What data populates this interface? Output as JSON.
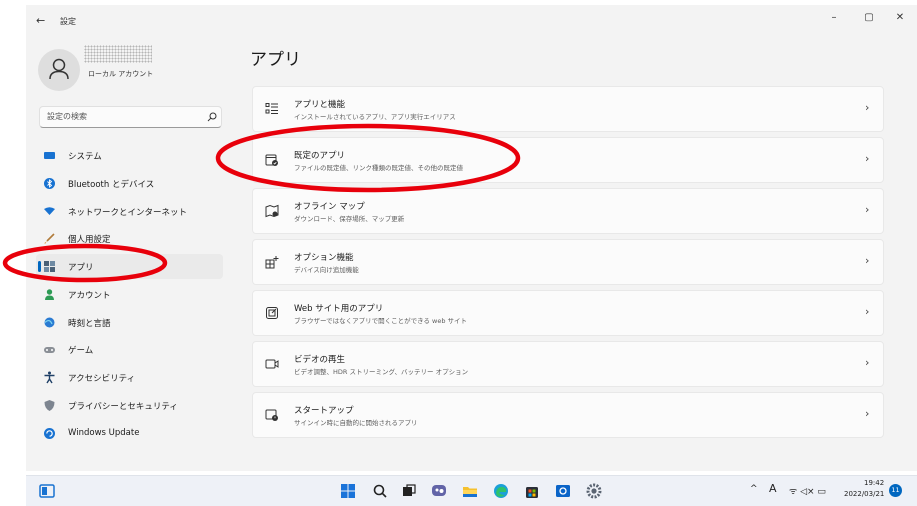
{
  "window": {
    "back": "←",
    "app_title": "設定",
    "controls": {
      "minimize": "–",
      "maximize": "▢",
      "close": "✕"
    }
  },
  "user": {
    "account_type": "ローカル アカウント"
  },
  "search": {
    "placeholder": "設定の検索"
  },
  "nav": {
    "selected": "アプリ",
    "items": [
      {
        "label": "システム",
        "icon": "monitor-icon"
      },
      {
        "label": "Bluetooth とデバイス",
        "icon": "bluetooth-icon"
      },
      {
        "label": "ネットワークとインターネット",
        "icon": "wifi-icon"
      },
      {
        "label": "個人用設定",
        "icon": "brush-icon"
      },
      {
        "label": "アプリ",
        "icon": "apps-icon"
      },
      {
        "label": "アカウント",
        "icon": "person-icon"
      },
      {
        "label": "時刻と言語",
        "icon": "globe-clock-icon"
      },
      {
        "label": "ゲーム",
        "icon": "gamepad-icon"
      },
      {
        "label": "アクセシビリティ",
        "icon": "accessibility-icon"
      },
      {
        "label": "プライバシーとセキュリティ",
        "icon": "shield-icon"
      },
      {
        "label": "Windows Update",
        "icon": "update-icon"
      }
    ]
  },
  "main": {
    "title": "アプリ",
    "cards": [
      {
        "title": "アプリと機能",
        "desc": "インストールされているアプリ、アプリ実行エイリアス",
        "icon": "list-icon"
      },
      {
        "title": "既定のアプリ",
        "desc": "ファイルの既定値、リンク種類の既定値、その他の既定値",
        "icon": "default-apps-icon"
      },
      {
        "title": "オフライン マップ",
        "desc": "ダウンロード、保存場所、マップ更新",
        "icon": "map-icon"
      },
      {
        "title": "オプション機能",
        "desc": "デバイス向け追加機能",
        "icon": "optional-features-icon"
      },
      {
        "title": "Web サイト用のアプリ",
        "desc": "ブラウザーではなくアプリで開くことができる web サイト",
        "icon": "web-apps-icon"
      },
      {
        "title": "ビデオの再生",
        "desc": "ビデオ調整、HDR ストリーミング、バッテリー オプション",
        "icon": "video-icon"
      },
      {
        "title": "スタートアップ",
        "desc": "サインイン時に自動的に開始されるアプリ",
        "icon": "startup-icon"
      }
    ],
    "chevron": "›"
  },
  "annotation_color": "#e8000b",
  "taskbar": {
    "apps": [
      "widgets-icon",
      "start-icon",
      "search-icon",
      "task-view-icon",
      "chat-icon",
      "file-explorer-icon",
      "edge-icon",
      "store-icon",
      "mail-icon",
      "settings-icon"
    ],
    "tray": {
      "chevron": "^",
      "ime": "A",
      "icons": "ᯤ ◁× ▭",
      "time": "19:42",
      "date": "2022/03/21",
      "notifications": "11"
    }
  },
  "colors": {
    "accent": "#0067c0",
    "window_bg": "#f3f3f3",
    "card_bg": "#fbfbfb",
    "taskbar_bg": "#eef1f7"
  }
}
